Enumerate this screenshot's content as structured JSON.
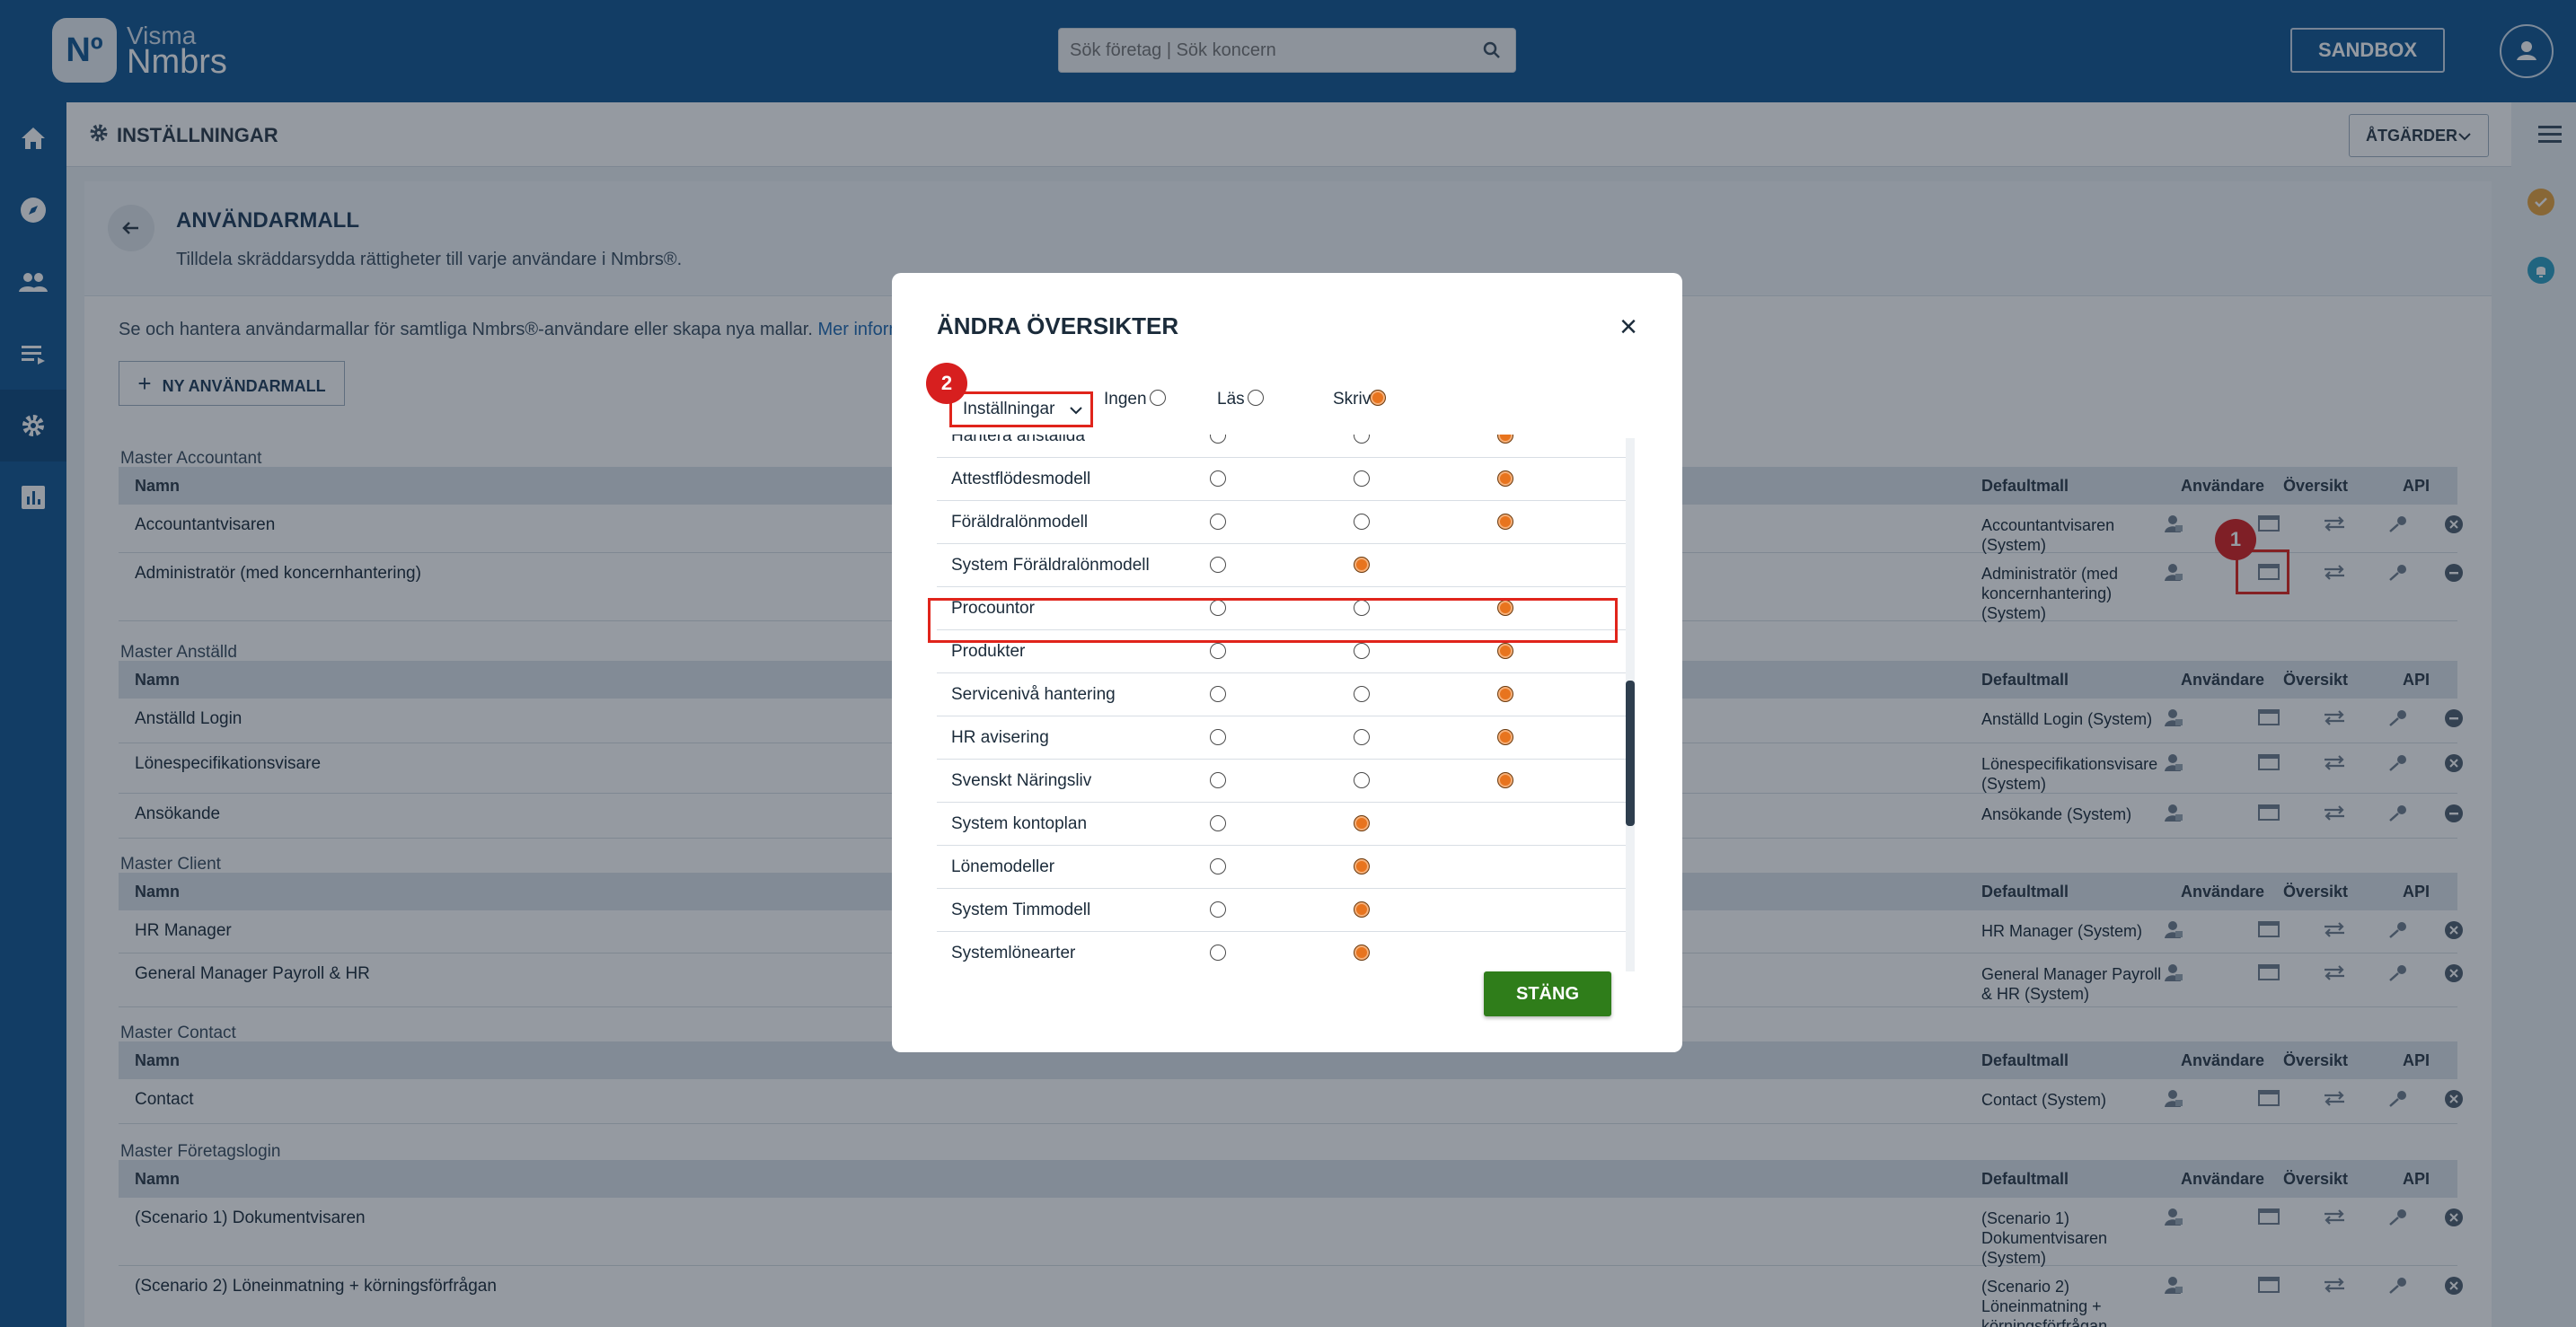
{
  "brand": {
    "logo_mark": "Nº",
    "line1": "Visma",
    "line2": "Nmbrs"
  },
  "search": {
    "placeholder": "Sök företag | Sök koncern"
  },
  "sandbox_label": "SANDBOX",
  "nav": [
    "home-icon",
    "compass-icon",
    "people-icon",
    "list-icon",
    "gear-icon",
    "chart-icon"
  ],
  "subheader": {
    "title": "INSTÄLLNINGAR",
    "actions_label": "ÅTGÄRDER"
  },
  "page": {
    "title": "ANVÄNDARMALL",
    "subtitle": "Tilldela skräddarsydda rättigheter till varje användare i Nmbrs®.",
    "intro": "Se och hantera användarmallar för samtliga Nmbrs®-användare eller skapa nya mallar.",
    "intro_link": "Mer inform",
    "new_button": "NY ANVÄNDARMALL"
  },
  "table_headers": {
    "name": "Namn",
    "default": "Defaultmall",
    "users": "Användare",
    "overview": "Översikt",
    "api": "API"
  },
  "groups": [
    {
      "label": "Master Accountant",
      "rows": [
        {
          "name": "Accountantvisaren",
          "default": [
            "Accountantvisaren",
            "(System)"
          ],
          "end": "x"
        },
        {
          "name": "Administratör (med koncernhantering)",
          "default": [
            "Administratör (med",
            "koncernhantering)",
            "(System)"
          ],
          "end": "minus"
        }
      ]
    },
    {
      "label": "Master Anställd",
      "rows": [
        {
          "name": "Anställd Login",
          "default": [
            "Anställd Login (System)"
          ],
          "end": "minus"
        },
        {
          "name": "Lönespecifikationsvisare",
          "default": [
            "Lönespecifikationsvisare",
            "(System)"
          ],
          "end": "x"
        },
        {
          "name": "Ansökande",
          "default": [
            "Ansökande (System)"
          ],
          "end": "minus"
        }
      ]
    },
    {
      "label": "Master Client",
      "rows": [
        {
          "name": "HR Manager",
          "default": [
            "HR Manager (System)"
          ],
          "end": "x"
        },
        {
          "name": "General Manager Payroll & HR",
          "default": [
            "General Manager Payroll",
            "& HR (System)"
          ],
          "end": "x"
        }
      ]
    },
    {
      "label": "Master Contact",
      "rows": [
        {
          "name": "Contact",
          "default": [
            "Contact (System)"
          ],
          "end": "x"
        }
      ]
    },
    {
      "label": "Master Företagslogin",
      "rows": [
        {
          "name": "(Scenario 1) Dokumentvisaren",
          "default": [
            "(Scenario 1)",
            "Dokumentvisaren",
            "(System)"
          ],
          "end": "x"
        },
        {
          "name": "(Scenario 2) Löneinmatning + körningsförfrågan",
          "default": [
            "(Scenario 2)",
            "Löneinmatning +",
            "körningsförfrågan"
          ],
          "end": "x"
        }
      ]
    }
  ],
  "modal": {
    "title": "ÄNDRA ÖVERSIKTER",
    "select_value": "Inställningar",
    "col_none": "Ingen",
    "col_read": "Läs",
    "col_write": "Skriv",
    "close_button": "STÄNG",
    "rows": [
      {
        "label": "Hantera anställda",
        "selected": "write"
      },
      {
        "label": "Attestflödesmodell",
        "selected": "write"
      },
      {
        "label": "Föräldralönmodell",
        "selected": "write"
      },
      {
        "label": "System Föräldralönmodell",
        "selected": "read"
      },
      {
        "label": "Procountor",
        "selected": "write"
      },
      {
        "label": "Produkter",
        "selected": "write"
      },
      {
        "label": "Servicenivå hantering",
        "selected": "write"
      },
      {
        "label": "HR avisering",
        "selected": "write"
      },
      {
        "label": "Svenskt Näringsliv",
        "selected": "write"
      },
      {
        "label": "System kontoplan",
        "selected": "read"
      },
      {
        "label": "Lönemodeller",
        "selected": "read"
      },
      {
        "label": "System Timmodell",
        "selected": "read"
      },
      {
        "label": "Systemlönearter",
        "selected": "read"
      }
    ]
  },
  "annotations": {
    "badge1": "1",
    "badge2": "2"
  },
  "colors": {
    "brand_blue": "#115692",
    "highlight_red": "#e0241b",
    "radio_orange": "#e8741e",
    "close_green": "#2f7d1a"
  }
}
